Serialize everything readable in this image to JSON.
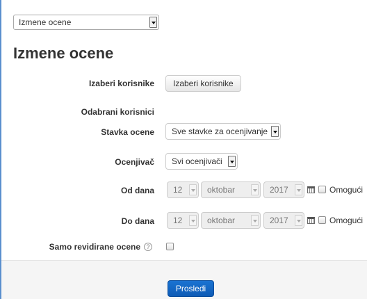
{
  "top_dropdown": {
    "value": "Izmene ocene"
  },
  "page": {
    "title": "Izmene ocene"
  },
  "form": {
    "select_users": {
      "label": "Izaberi korisnike",
      "button": "Izaberi korisnike"
    },
    "selected_users": {
      "label": "Odabrani korisnici"
    },
    "grade_item": {
      "label": "Stavka ocene",
      "value": "Sve stavke za ocenjivanje"
    },
    "grader": {
      "label": "Ocenjivač",
      "value": "Svi ocenjivači"
    },
    "date_from": {
      "label": "Od dana",
      "day": "12",
      "month": "oktobar",
      "year": "2017",
      "enable_label": "Omogući",
      "enabled": false
    },
    "date_to": {
      "label": "Do dana",
      "day": "12",
      "month": "oktobar",
      "year": "2017",
      "enable_label": "Omogući",
      "enabled": false
    },
    "revised_only": {
      "label": "Samo revidirane ocene",
      "help_glyph": "?",
      "checked": false
    }
  },
  "footer": {
    "submit": "Prosledi"
  },
  "colors": {
    "primary": "#0e5bb5",
    "frame": "#5a8fce",
    "text": "#333333"
  }
}
